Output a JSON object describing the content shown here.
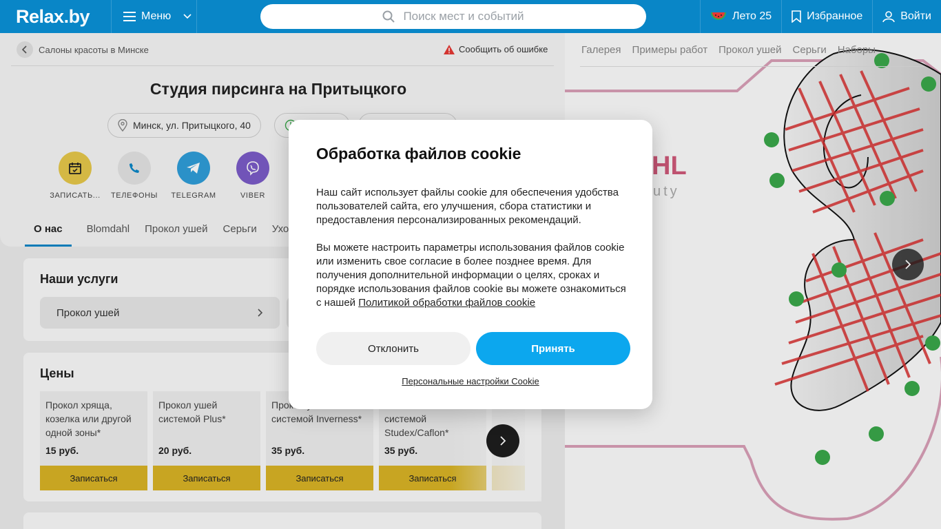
{
  "header": {
    "logo": "Relax",
    "logo_suffix": ".by",
    "menu_label": "Меню",
    "search_placeholder": "Поиск мест и событий",
    "summer_label": "Лето 25",
    "favorites_label": "Избранное",
    "login_label": "Войти"
  },
  "breadcrumb": {
    "label": "Салоны красоты в Минске"
  },
  "report_label": "Сообщить об ошибке",
  "page_title": "Студия пирсинга на Притыцкого",
  "address": "Минск, ул. Притыцкого, 40",
  "actions": [
    {
      "label": "ЗАПИСАТЬ...",
      "icon": "calendar-icon",
      "color": "#e6c84a"
    },
    {
      "label": "ТЕЛЕФОНЫ",
      "icon": "phone-icon",
      "color": "#e4e4e4"
    },
    {
      "label": "TELEGRAM",
      "icon": "telegram-icon",
      "color": "#2f9ed9"
    },
    {
      "label": "VIBER",
      "icon": "viber-icon",
      "color": "#7b5cc8"
    }
  ],
  "tabs": [
    "О нас",
    "Blomdahl",
    "Прокол ушей",
    "Серьги",
    "Уход"
  ],
  "services": {
    "title": "Наши услуги",
    "items": [
      "Прокол ушей"
    ]
  },
  "prices": {
    "title": "Цены",
    "book_label": "Записаться",
    "items": [
      {
        "name": "Прокол хряща, козелка или другой одной зоны*",
        "price": "15 руб."
      },
      {
        "name": "Прокол ушей системой Plus*",
        "price": "20 руб."
      },
      {
        "name": "Прокол ушей системой Inverness*",
        "price": "35 руб."
      },
      {
        "name": "системой Studex/Caflon*",
        "price": "35 руб."
      }
    ]
  },
  "gallery": {
    "tabs": [
      "Галерея",
      "Примеры работ",
      "Прокол ушей",
      "Серьги",
      "Наборы"
    ],
    "brand_text": "HL",
    "brand_sub": "uty"
  },
  "cookie": {
    "title": "Обработка файлов cookie",
    "para1": "Наш сайт использует файлы cookie для обеспечения удобства пользователей сайта, его улучшения, сбора статистики и предоставления персонализированных рекомендаций.",
    "para2": "Вы можете настроить параметры использования файлов cookie или изменить свое согласие в более позднее время. Для получения дополнительной информации о целях, сроках и порядке использования файлов cookie вы можете ознакомиться с нашей",
    "policy_link": "Политикой обработки файлов cookie",
    "decline_label": "Отклонить",
    "accept_label": "Принять",
    "settings_label": "Персональные настройки Cookie"
  },
  "colors": {
    "brand_blue": "#0986c7",
    "accent_yellow": "#d9b425",
    "accept_blue": "#0ca7ee"
  }
}
